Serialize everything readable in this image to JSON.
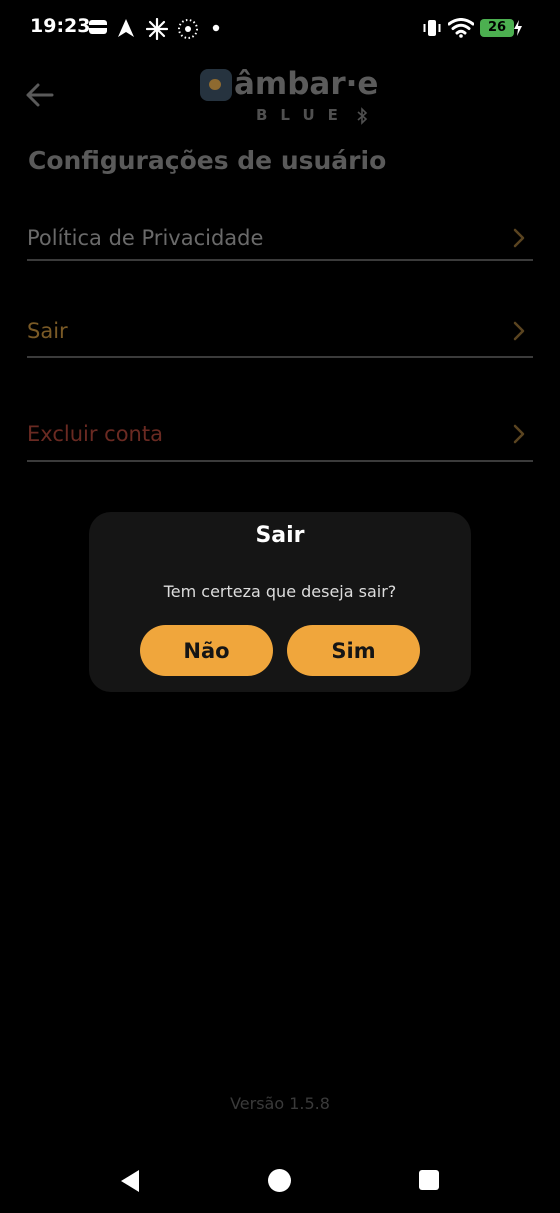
{
  "status_bar": {
    "time": "19:23",
    "battery": "26"
  },
  "header": {
    "logo_word": "âmbar·e",
    "logo_sub": "BLUE"
  },
  "page": {
    "title": "Configurações de usuário"
  },
  "menu": {
    "items": [
      {
        "label": "Política de Privacidade",
        "color": "#6a6a6a"
      },
      {
        "label": "Sair",
        "color": "#7a5a26"
      },
      {
        "label": "Excluir conta",
        "color": "#6a2a22"
      }
    ]
  },
  "footer": {
    "version": "Versão 1.5.8"
  },
  "dialog": {
    "title": "Sair",
    "message": "Tem certeza que deseja sair?",
    "no_label": "Não",
    "yes_label": "Sim"
  },
  "colors": {
    "accent": "#f0a63c",
    "dialog_bg": "#151515",
    "battery": "#4caf50"
  },
  "icons": [
    "back-arrow-icon",
    "chevron-right-icon",
    "wifi-icon",
    "vibrate-icon",
    "battery-icon",
    "bluetooth-icon",
    "nav-back-icon",
    "nav-home-icon",
    "nav-recents-icon"
  ]
}
